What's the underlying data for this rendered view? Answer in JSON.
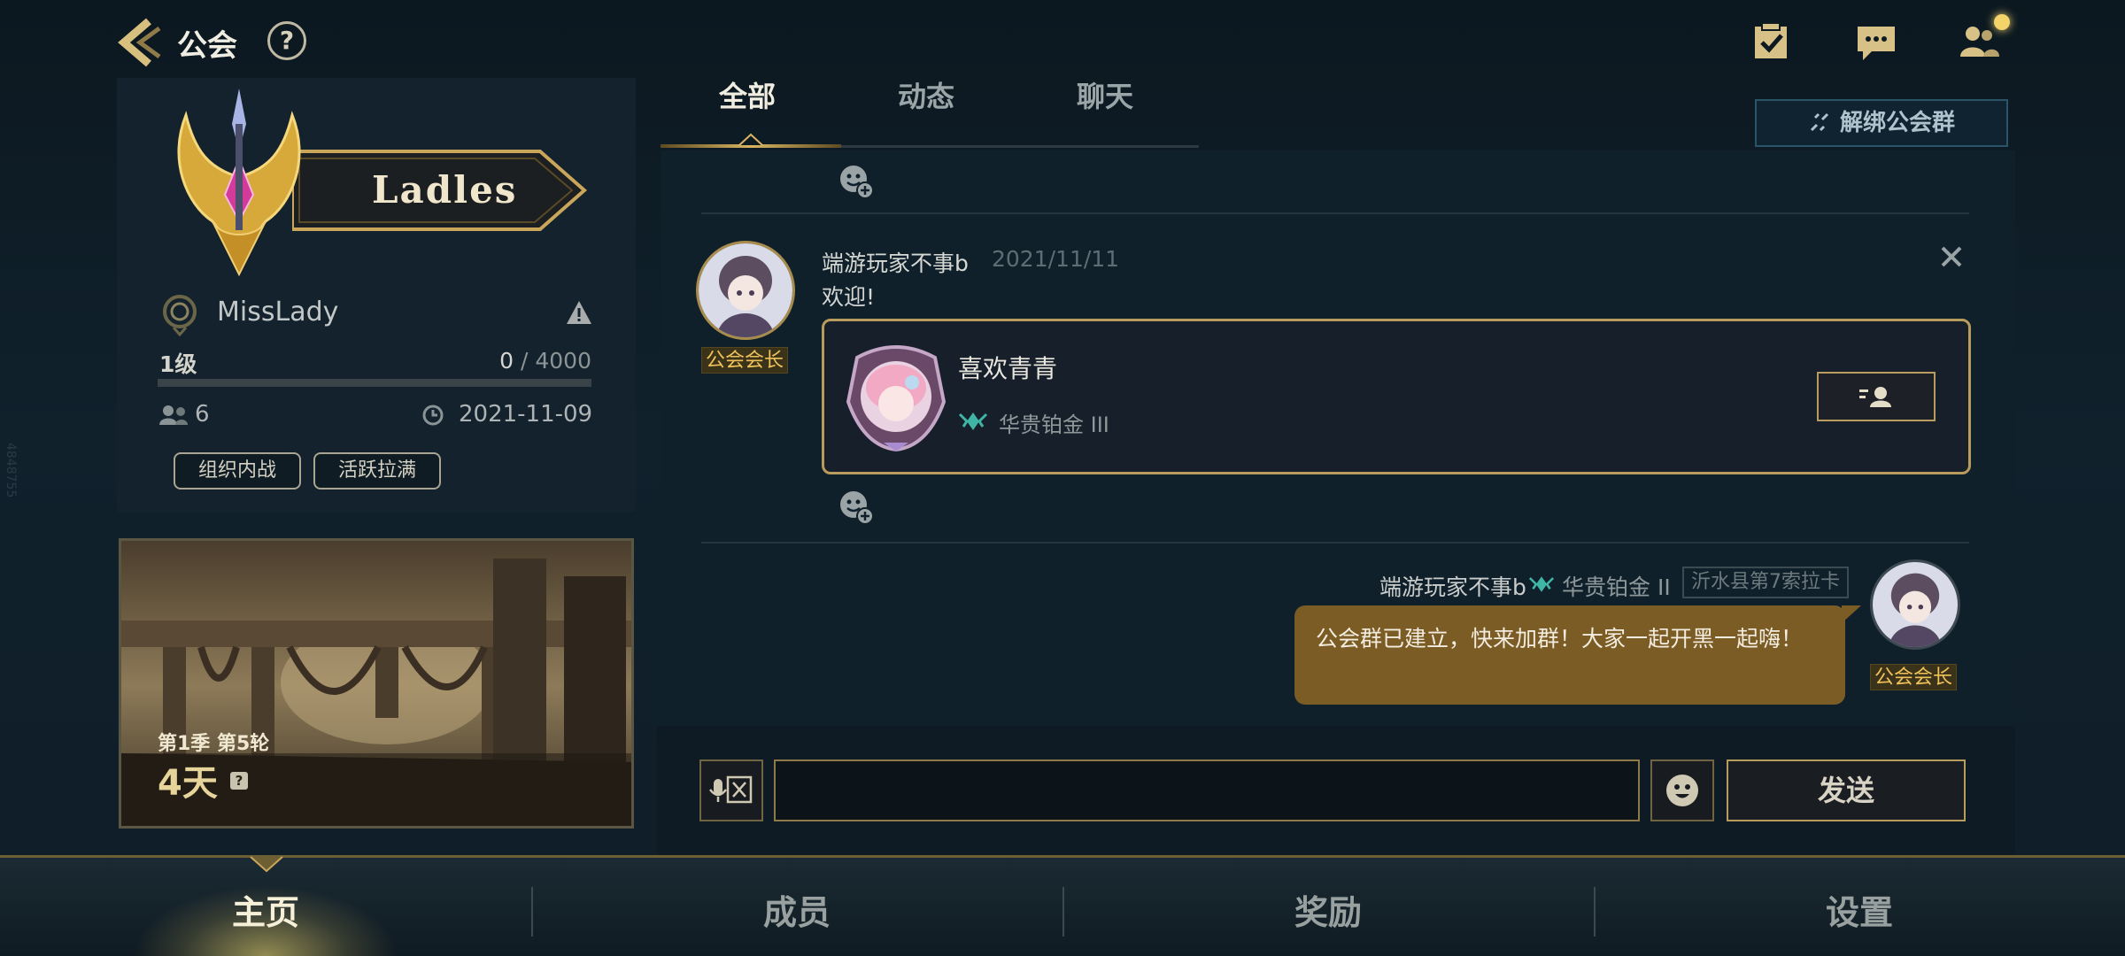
{
  "header": {
    "title": "公会",
    "help_label": "?"
  },
  "guild": {
    "name": "Ladles",
    "owner": "MissLady",
    "level": "1级",
    "exp_current": "0",
    "exp_max": "/ 4000",
    "exp_progress": 0,
    "members": "6",
    "created": "2021-11-09",
    "tags": [
      "组织内战",
      "活跃拉满"
    ]
  },
  "season": {
    "label": "第1季 第5轮",
    "days_left": "4天",
    "help_label": "?"
  },
  "tabs": [
    {
      "label": "全部",
      "active": true
    },
    {
      "label": "动态",
      "active": false
    },
    {
      "label": "聊天",
      "active": false
    }
  ],
  "unbind_button": "解绑公会群",
  "post": {
    "author": "端游玩家不事b",
    "time": "2021/11/11",
    "message": "欢迎!",
    "badge": "公会会长",
    "card": {
      "name": "喜欢青青",
      "rank": "华贵铂金 III"
    }
  },
  "chat": {
    "author": "端游玩家不事b",
    "rank": "华贵铂金 II",
    "title": "沂水县第7索拉卡",
    "message": "公会群已建立，快来加群！大家一起开黑一起嗨！",
    "badge": "公会会长"
  },
  "input": {
    "placeholder": "",
    "send_label": "发送"
  },
  "bottom_nav": [
    {
      "label": "主页",
      "active": true
    },
    {
      "label": "成员",
      "active": false
    },
    {
      "label": "奖励",
      "active": false
    },
    {
      "label": "设置",
      "active": false
    }
  ],
  "side_id": "4848755",
  "colors": {
    "accent_gold": "#c8a85a",
    "bubble": "#7b5c24",
    "background": "#10202b"
  }
}
